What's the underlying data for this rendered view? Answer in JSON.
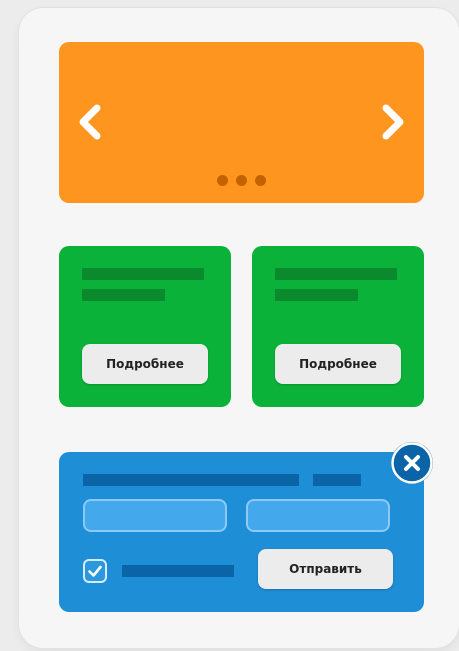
{
  "colors": {
    "page_background": "#ececec",
    "panel_background": "#f6f6f6",
    "carousel_background": "#fe951f",
    "carousel_dot": "#c46200",
    "card_background": "#0bb23a",
    "card_placeholder": "#0a8a2d",
    "form_background": "#1e8ed6",
    "form_placeholder": "#0b64a8",
    "button_background": "#ececec",
    "close_button": "#0b64a8"
  },
  "carousel": {
    "prev_icon": "chevron-left-icon",
    "next_icon": "chevron-right-icon",
    "dots": [
      {
        "name": "carousel-dot-1"
      },
      {
        "name": "carousel-dot-2"
      },
      {
        "name": "carousel-dot-3"
      }
    ]
  },
  "cards": [
    {
      "button_label": "Подробнее"
    },
    {
      "button_label": "Подробнее"
    }
  ],
  "form": {
    "checkbox_checked": true,
    "submit_label": "Отправить",
    "close_icon": "close-icon"
  }
}
